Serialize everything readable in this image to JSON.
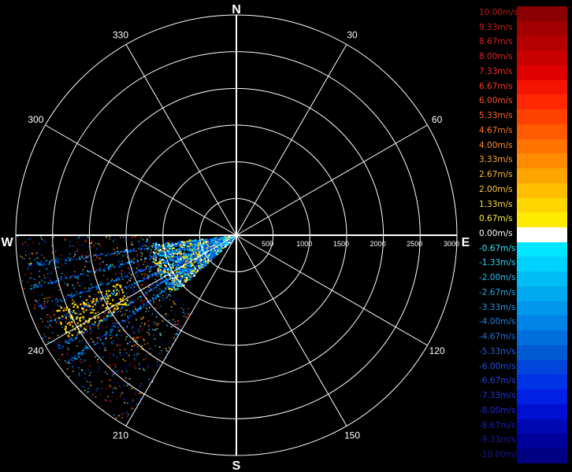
{
  "radar": {
    "compass": {
      "north": "N",
      "east": "E",
      "south": "S",
      "west": "W"
    },
    "bearing_labels": [
      "30",
      "60",
      "120",
      "150",
      "210",
      "240",
      "300",
      "330"
    ],
    "bearing_values": [
      30,
      60,
      120,
      150,
      210,
      240,
      300,
      330
    ],
    "range_labels": [
      "500",
      "1000",
      "1500",
      "2000",
      "2500",
      "3000"
    ],
    "range_values": [
      500,
      1000,
      1500,
      2000,
      2500,
      3000
    ],
    "max_range": 3000,
    "spoke_step_deg": 30,
    "data_sector_deg": [
      210,
      270
    ],
    "colors": {
      "background": "#000000",
      "grid": "#ffffff",
      "text": "#ffffff"
    }
  },
  "legend": {
    "items": [
      {
        "label": "10.00m/s",
        "color": "#8b0000",
        "text_color": "#c81414"
      },
      {
        "label": "9.33m/s",
        "color": "#a00000",
        "text_color": "#d21919"
      },
      {
        "label": "8.67m/s",
        "color": "#b40000",
        "text_color": "#dc1e1e"
      },
      {
        "label": "8.00m/s",
        "color": "#c80000",
        "text_color": "#e62323"
      },
      {
        "label": "7.33m/s",
        "color": "#e10000",
        "text_color": "#ff2a2a"
      },
      {
        "label": "6.67m/s",
        "color": "#f51400",
        "text_color": "#ff3c1e"
      },
      {
        "label": "6.00m/s",
        "color": "#ff2800",
        "text_color": "#ff4e28"
      },
      {
        "label": "5.33m/s",
        "color": "#ff4100",
        "text_color": "#ff6428"
      },
      {
        "label": "4.67m/s",
        "color": "#ff5a00",
        "text_color": "#ff7a28"
      },
      {
        "label": "4.00m/s",
        "color": "#ff7300",
        "text_color": "#ff9030"
      },
      {
        "label": "3.33m/s",
        "color": "#ff8c00",
        "text_color": "#ffa438"
      },
      {
        "label": "2.67m/s",
        "color": "#ffa500",
        "text_color": "#ffb840"
      },
      {
        "label": "2.00m/s",
        "color": "#ffbe00",
        "text_color": "#ffc840"
      },
      {
        "label": "1.33m/s",
        "color": "#ffd700",
        "text_color": "#ffdc40"
      },
      {
        "label": "0.67m/s",
        "color": "#ffeb00",
        "text_color": "#ffee40"
      },
      {
        "label": "0.00m/s",
        "color": "#ffffff",
        "text_color": "#ffffff"
      },
      {
        "label": "-0.67m/s",
        "color": "#00e6ff",
        "text_color": "#2ee8ff"
      },
      {
        "label": "-1.33m/s",
        "color": "#00d2ff",
        "text_color": "#2ad6ff"
      },
      {
        "label": "-2.00m/s",
        "color": "#00bef5",
        "text_color": "#22c2f5"
      },
      {
        "label": "-2.67m/s",
        "color": "#00aaf0",
        "text_color": "#1eaef0"
      },
      {
        "label": "-3.33m/s",
        "color": "#0096eb",
        "text_color": "#1e9aeb"
      },
      {
        "label": "-4.00m/s",
        "color": "#0082e6",
        "text_color": "#1e86e6"
      },
      {
        "label": "-4.67m/s",
        "color": "#006edc",
        "text_color": "#1e72e6"
      },
      {
        "label": "-5.33m/s",
        "color": "#005ad2",
        "text_color": "#1e60e6"
      },
      {
        "label": "-6.00m/s",
        "color": "#0046dc",
        "text_color": "#1e50f0"
      },
      {
        "label": "-6.67m/s",
        "color": "#0032e6",
        "text_color": "#1e40f0"
      },
      {
        "label": "-7.33m/s",
        "color": "#0020e6",
        "text_color": "#1e32f0"
      },
      {
        "label": "-8.00m/s",
        "color": "#0010d2",
        "text_color": "#1e26e0"
      },
      {
        "label": "-8.67m/s",
        "color": "#0008b4",
        "text_color": "#1a1ec8"
      },
      {
        "label": "-9.33m/s",
        "color": "#00009b",
        "text_color": "#1a1ab0"
      },
      {
        "label": "-10.00m/s",
        "color": "#000082",
        "text_color": "#161696"
      }
    ]
  }
}
